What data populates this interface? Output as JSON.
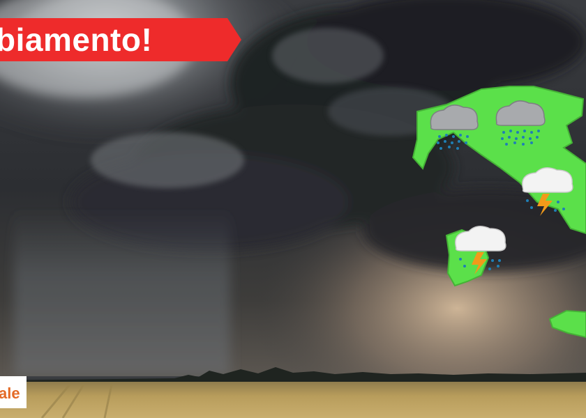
{
  "banner": {
    "text": "biamento!",
    "color": "#ee2b2b"
  },
  "badge": {
    "text": "ale",
    "color": "#e46a26"
  },
  "scene": {
    "description_icons": [
      "storm-cloud",
      "map-italy",
      "rain-cloud-icon",
      "thunderstorm-icon",
      "wheat-field"
    ],
    "colors": {
      "map_green": "#5be04a",
      "sky_dark": "#2b2d31",
      "field": "#b89d5c"
    }
  }
}
